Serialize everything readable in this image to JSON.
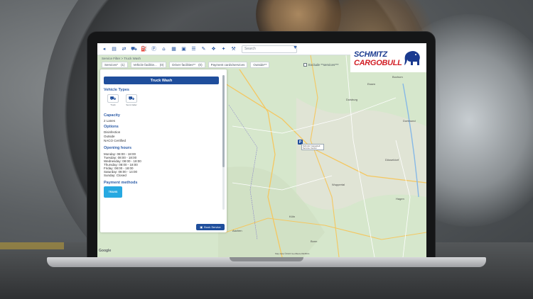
{
  "toolbar": {
    "search_placeholder": "Search",
    "breadcrumb": "Service Filter > Truck Wash",
    "sub_breadcrumb": "Truck washing & NOCO Certified, Inc"
  },
  "filters": [
    {
      "label": "Services*",
      "count": "(1)"
    },
    {
      "label": "Vehicle facilitie...",
      "count": "(0)"
    },
    {
      "label": "Driver facilities**",
      "count": "(0)"
    },
    {
      "label": "Payment cards/services",
      "count": ""
    },
    {
      "label": "Outside**",
      "count": ""
    }
  ],
  "exclude_label": "Exclude **services***",
  "logo": {
    "line1": "SCHMITZ",
    "line2": "CARGOBULL"
  },
  "panel": {
    "button": "Truck Wash",
    "vehicle_types_title": "Vehicle Types",
    "vehicle_types": [
      {
        "icon": "truck-icon",
        "label": "Truck"
      },
      {
        "icon": "semi-trailer-icon",
        "label": "Semi trailer"
      }
    ],
    "capacity_title": "Capacity",
    "capacity": "2 Lanes",
    "options_title": "Options",
    "options": [
      "Disinfection",
      "Outside",
      "NACO Certified"
    ],
    "hours_title": "Opening hours",
    "hours": [
      "Monday: 08:00 - 18:00",
      "Tuesday: 08:00 - 18:00",
      "Wednesday: 08:00 - 18:00",
      "Thursday: 08:00 - 18:00",
      "Friday: 08:00 - 18:00",
      "Saturday: 08:00 - 14:00",
      "Sunday: Closed"
    ],
    "payment_title": "Payment methods",
    "payment_badge": "TRAVIS",
    "book_button": "Book Service"
  },
  "map": {
    "poi_label": "Schmitz Cargobull Service Center",
    "poi_marker": "P",
    "cities": [
      "Düsseldorf",
      "Duisburg",
      "Essen",
      "Bochum",
      "Dortmund",
      "Wuppertal",
      "Hagen",
      "Köln",
      "Bonn",
      "Aachen"
    ],
    "google": "Google",
    "copyright": "Map data ©2024 GeoBasis-DE/BKG"
  },
  "colors": {
    "brand_blue": "#1f4e9c",
    "brand_red": "#d21f26",
    "map_green": "#d9e8d0"
  }
}
